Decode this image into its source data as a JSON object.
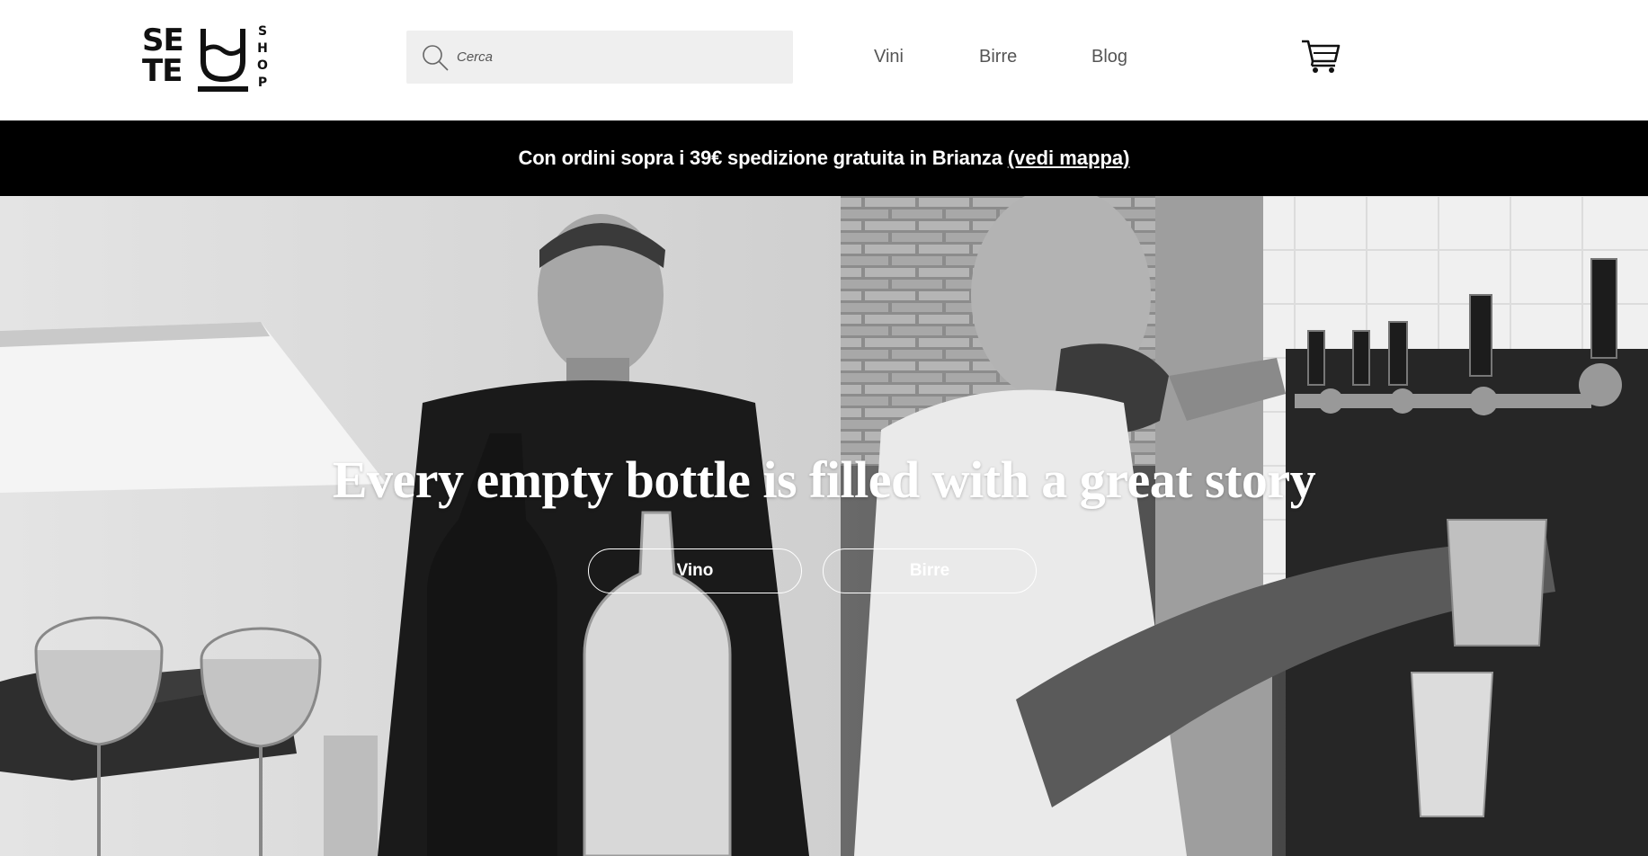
{
  "logo": {
    "line1": "SE",
    "line2": "TE",
    "side": "SHOP"
  },
  "search": {
    "placeholder": "Cerca",
    "icon": "search-icon"
  },
  "nav": {
    "items": [
      {
        "label": "Vini"
      },
      {
        "label": "Birre"
      },
      {
        "label": "Blog"
      }
    ]
  },
  "cart": {
    "icon": "cart-icon"
  },
  "announcement": {
    "text": "Con ordini sopra i 39€ spedizione gratuita in Brianza",
    "link": "(vedi mappa)"
  },
  "hero": {
    "headline": "Every empty bottle is filled with a great story",
    "buttons": [
      {
        "label": "Vino"
      },
      {
        "label": "Birre"
      }
    ],
    "style": "black-and-white photo"
  },
  "colors": {
    "bar_bg": "#000000",
    "search_bg": "#efefef",
    "nav_text": "#555555"
  }
}
